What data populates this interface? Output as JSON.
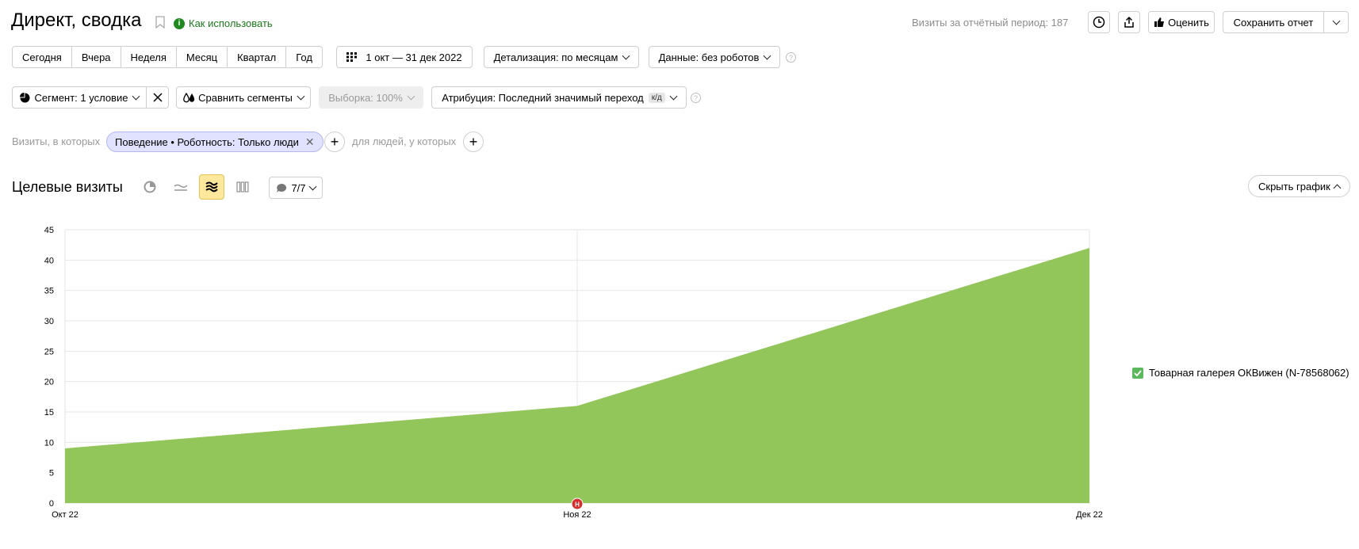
{
  "header": {
    "title": "Директ, сводка",
    "how_to_use": "Как использовать",
    "visits_period": "Визиты за отчётный период: 187",
    "rate_label": "Оценить",
    "save_report_label": "Сохранить отчет"
  },
  "toolbar": {
    "periods": [
      "Сегодня",
      "Вчера",
      "Неделя",
      "Месяц",
      "Квартал",
      "Год"
    ],
    "date_range": "1 окт — 31 дек 2022",
    "detail": "Детализация: по месяцам",
    "data_mode": "Данные: без роботов"
  },
  "segment_bar": {
    "segment": "Сегмент: 1 условие",
    "compare": "Сравнить сегменты",
    "sample": "Выборка: 100%",
    "attribution": "Атрибуция: Последний значимый переход",
    "attribution_badge": "к/д"
  },
  "filters": {
    "visits_prefix": "Визиты, в которых",
    "chip": "Поведение • Роботность: Только люди",
    "people_prefix": "для людей, у которых"
  },
  "chart_header": {
    "title": "Целевые визиты",
    "annotations_count": "7/7",
    "hide_chart": "Скрыть график"
  },
  "chart_data": {
    "type": "area",
    "x": [
      "Окт 22",
      "Ноя 22",
      "Дек 22"
    ],
    "series": [
      {
        "name": "Товарная галерея ОКВижен (N-78568062)",
        "values": [
          9,
          16,
          42
        ],
        "color": "#92c55a"
      }
    ],
    "ylim": [
      0,
      45
    ],
    "yticks": [
      0,
      5,
      10,
      15,
      20,
      25,
      30,
      35,
      40,
      45
    ],
    "annotation_marker": {
      "x": "Ноя 22",
      "label": "Н"
    },
    "legend": "right",
    "grid": true
  }
}
